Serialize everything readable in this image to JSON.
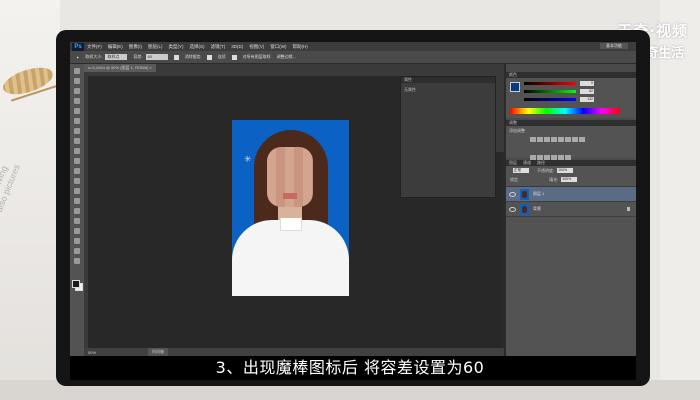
{
  "watermark": {
    "line1": "天奇·视频",
    "line2": "天奇生活"
  },
  "background_text": {
    "line1": "Quiet living",
    "line2": "also pictures"
  },
  "photoshop": {
    "app_badge": "Ps",
    "menu": [
      "文件(F)",
      "编辑(E)",
      "图像(I)",
      "图层(L)",
      "类型(Y)",
      "选择(S)",
      "滤镜(T)",
      "3D(D)",
      "视图(V)",
      "窗口(W)",
      "帮助(H)"
    ],
    "workspace_button": "基本功能",
    "options": {
      "sample_size_label": "取样大小:",
      "sample_size_value": "取样点",
      "tolerance_label": "容差:",
      "tolerance_value": "60",
      "antialias_label": "消除锯齿",
      "contiguous_label": "连续",
      "all_layers_label": "对所有图层取样",
      "refine_edge": "调整边缘..."
    },
    "document_tab": "u=3,2064 @ 50% (图层 1, RGB/8) ×",
    "status_zoom": "50%",
    "status_tab": "时间轴",
    "properties_panel": {
      "title": "属性",
      "subtitle": "无属性"
    },
    "color_panel": {
      "title": "颜色",
      "values": [
        "0",
        "62",
        "132"
      ]
    },
    "adjustments_panel": {
      "title": "调整",
      "subtitle": "添加调整"
    },
    "layers_panel": {
      "tabs": [
        "图层",
        "通道",
        "路径"
      ],
      "blend_mode": "正常",
      "opacity_label": "不透明度:",
      "opacity_value": "100%",
      "lock_label": "锁定:",
      "fill_label": "填充:",
      "fill_value": "100%",
      "layers": [
        {
          "name": "图层 1",
          "selected": true
        },
        {
          "name": "背景",
          "selected": false
        }
      ]
    }
  },
  "caption": "3、出现魔棒图标后 将容差设置为60"
}
